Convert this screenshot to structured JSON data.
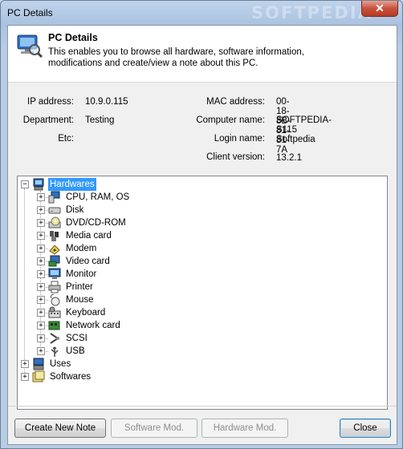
{
  "window": {
    "title": "PC Details",
    "close_label": "✕",
    "watermark": "SOFTPEDIA"
  },
  "header": {
    "title": "PC Details",
    "description": "This enables you to browse all hardware, software information, modifications and create/view a note about this PC."
  },
  "info": {
    "ip_label": "IP address:",
    "ip_value": "10.9.0.115",
    "dept_label": "Department:",
    "dept_value": "Testing",
    "etc_label": "Etc:",
    "etc_value": "",
    "mac_label": "MAC address:",
    "mac_value": "00-18-8B-81-81-7A",
    "computer_label": "Computer name:",
    "computer_value": "SOFTPEDIA-S115",
    "login_label": "Login name:",
    "login_value": "Softpedia",
    "client_label": "Client version:",
    "client_value": "13.2.1"
  },
  "tree": {
    "root": {
      "label": "Hardwares",
      "icon": "computer-icon",
      "expanded": true,
      "selected": true
    },
    "children": [
      {
        "label": "CPU, RAM, OS",
        "icon": "cpu-icon"
      },
      {
        "label": "Disk",
        "icon": "disk-icon"
      },
      {
        "label": "DVD/CD-ROM",
        "icon": "dvd-icon"
      },
      {
        "label": "Media card",
        "icon": "media-card-icon"
      },
      {
        "label": "Modem",
        "icon": "modem-icon"
      },
      {
        "label": "Video card",
        "icon": "video-card-icon"
      },
      {
        "label": "Monitor",
        "icon": "monitor-icon"
      },
      {
        "label": "Printer",
        "icon": "printer-icon"
      },
      {
        "label": "Mouse",
        "icon": "mouse-icon"
      },
      {
        "label": "Keyboard",
        "icon": "keyboard-icon"
      },
      {
        "label": "Network card",
        "icon": "network-card-icon"
      },
      {
        "label": "SCSI",
        "icon": "scsi-icon"
      },
      {
        "label": "USB",
        "icon": "usb-icon"
      }
    ],
    "others": [
      {
        "label": "Uses",
        "icon": "uses-icon"
      },
      {
        "label": "Softwares",
        "icon": "softwares-icon"
      }
    ]
  },
  "buttons": {
    "create_note": "Create New Note",
    "software_mod": "Software Mod.",
    "hardware_mod": "Hardware Mod.",
    "close": "Close"
  },
  "colors": {
    "selection": "#3399ff",
    "title_bar": "#bfd3eb",
    "close_button": "#c7523d"
  }
}
